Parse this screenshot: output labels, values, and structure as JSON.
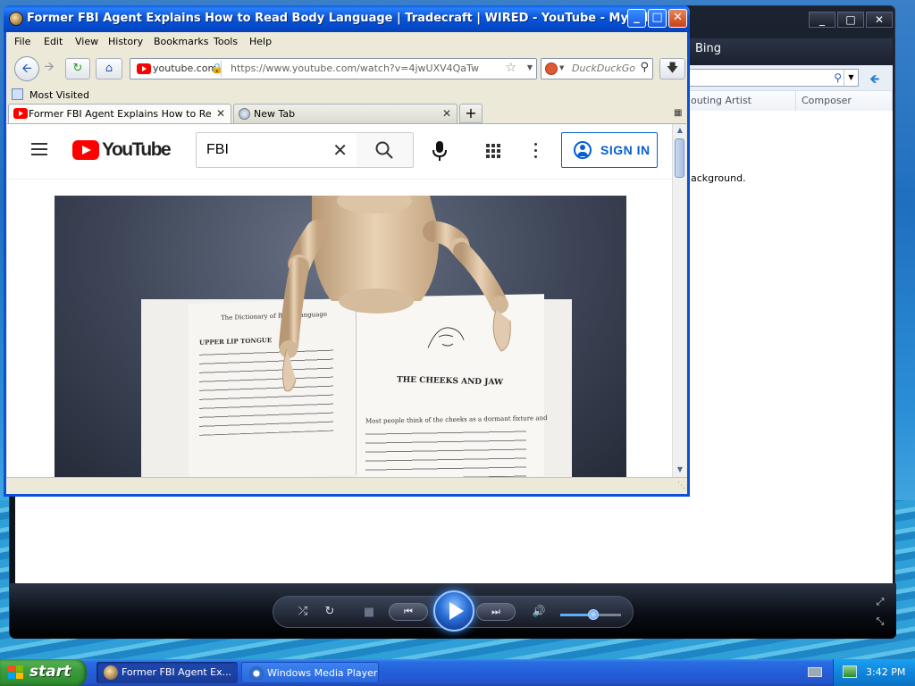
{
  "wmp": {
    "title": "Windows Media Player",
    "nav_label": "Bing",
    "columns": [
      "Contributing Artist",
      "Composer"
    ],
    "column_visible": [
      "outing Artist",
      "Composer"
    ],
    "bg_text": "ackground.",
    "window_buttons": [
      "_",
      "□",
      "✕"
    ],
    "controls": {
      "shuffle": "⤮",
      "repeat": "↻",
      "stop": "■",
      "prev": "⏮",
      "next": "⏭",
      "mute": "🔊",
      "volume_level": 0.55,
      "fullscreen": "⤢",
      "switch_view": "⤡"
    }
  },
  "firefox": {
    "window_title": "Former FBI Agent Explains How to Read Body Language | Tradecraft | WIRED - YouTube - Mypal",
    "menu": [
      "File",
      "Edit",
      "View",
      "History",
      "Bookmarks",
      "Tools",
      "Help"
    ],
    "site_badge": "youtube.com",
    "url": "https://www.youtube.com/watch?v=4jwUXV4QaTw",
    "search_placeholder": "DuckDuckGo",
    "bookmarks": [
      "Most Visited"
    ],
    "tabs": [
      {
        "label": "Former FBI Agent Explains How to Read ...",
        "active": true
      },
      {
        "label": "New Tab",
        "active": false
      }
    ],
    "new_tab": "+",
    "icons": {
      "back": "back-arrow-icon",
      "forward": "forward-arrow-icon",
      "reload": "reload-icon",
      "home": "home-icon",
      "download": "download-icon"
    }
  },
  "youtube": {
    "wordmark": "YouTube",
    "search_query": "FBI",
    "clear": "✕",
    "sign_in": "SIGN IN",
    "video": {
      "book_chapter": "THE CHEEKS AND JAW",
      "left_page_header": "The Dictionary of Body Language",
      "left_page_lead": "UPPER LIP TONGUE",
      "right_page_lead": "Most people think of the cheeks as a dormant fixture and"
    }
  },
  "taskbar": {
    "start_label": "start",
    "tasks": [
      {
        "label": "Former FBI Agent Ex...",
        "active": true
      },
      {
        "label": "Windows Media Player",
        "active": false
      }
    ],
    "clock": "3:42 PM"
  },
  "colors": {
    "xp_title_blue": "#0a56d8",
    "youtube_red": "#ff0000",
    "signin_blue": "#065fd4",
    "start_green": "#3c9c3c",
    "wmp_play_blue": "#2a6fd8"
  }
}
